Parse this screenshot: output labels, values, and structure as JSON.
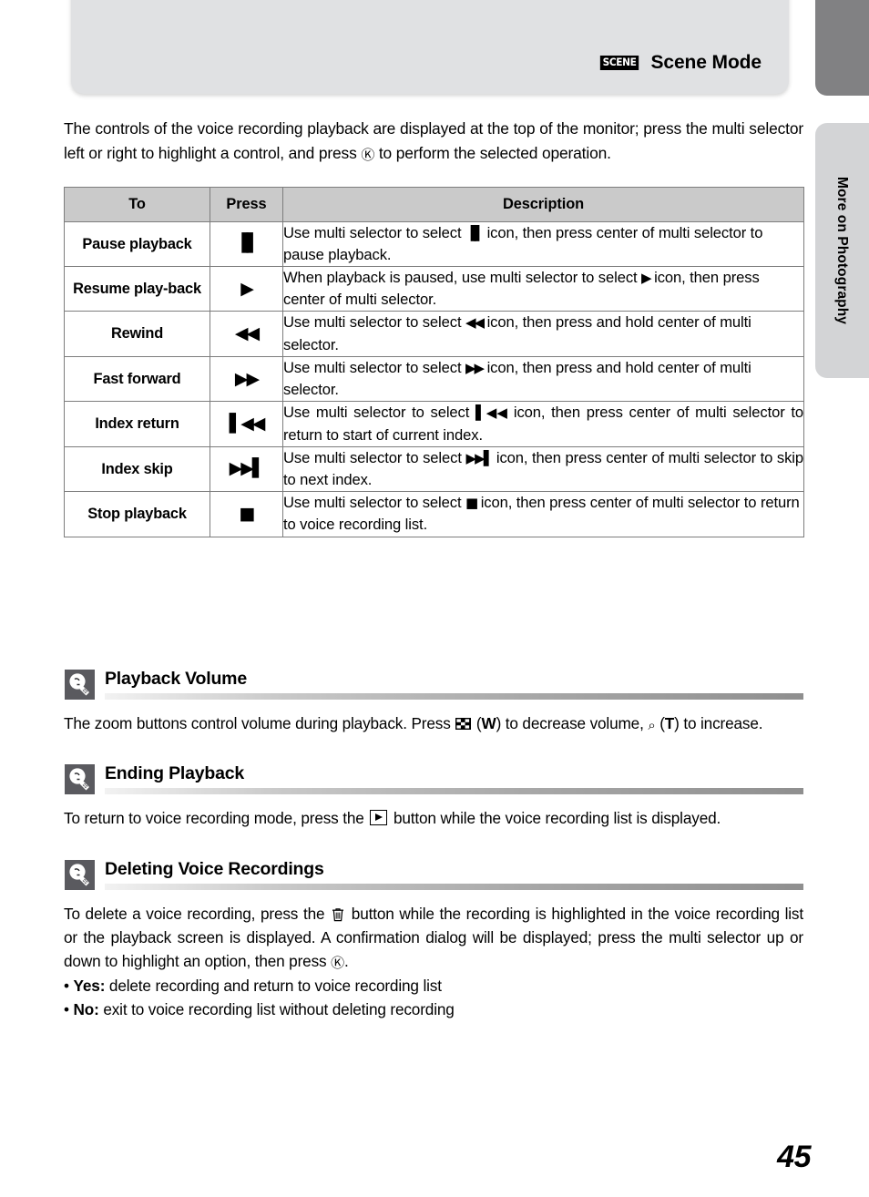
{
  "header": {
    "badge_label": "SCENE",
    "badge_icon": "scene-mode-icon",
    "title": "Scene Mode"
  },
  "side_tab": {
    "label": "More on Photography"
  },
  "intro": {
    "text_part1": "The controls of the voice recording playback are displayed at the top of the monitor; press the multi selector left or right to highlight a control, and press ",
    "ok_glyph": "Ⓚ",
    "text_part2": " to perform the selected operation."
  },
  "table": {
    "headers": {
      "to": "To",
      "press": "Press",
      "description": "Description"
    },
    "rows": [
      {
        "to": "Pause playback",
        "press_glyph": "▐▌",
        "press_icon": "pause-icon",
        "desc_pre": "Use multi selector to select ",
        "desc_glyph": "▐▌",
        "desc_post": " icon, then press center of multi selector to pause playback.",
        "justify": false
      },
      {
        "to": "Resume play-back",
        "press_glyph": "▶",
        "press_icon": "play-icon",
        "desc_pre": "When playback is paused, use multi selector to select ",
        "desc_glyph": "▶",
        "desc_post": " icon, then press center of multi selector.",
        "justify": false
      },
      {
        "to": "Rewind",
        "press_glyph": "◀◀",
        "press_icon": "rewind-icon",
        "desc_pre": "Use multi selector to select ",
        "desc_glyph": "◀◀",
        "desc_post": " icon, then press and hold center of multi selector.",
        "justify": false
      },
      {
        "to": "Fast forward",
        "press_glyph": "▶▶",
        "press_icon": "fast-forward-icon",
        "desc_pre": "Use multi selector to select ",
        "desc_glyph": "▶▶",
        "desc_post": " icon, then press and hold center of multi selector.",
        "justify": false
      },
      {
        "to": "Index return",
        "press_glyph": "▌◀◀",
        "press_icon": "index-return-icon",
        "desc_pre": "Use multi selector to select ",
        "desc_glyph": "▌◀◀",
        "desc_post": " icon, then press center of multi selector to return to start of current index.",
        "justify": true
      },
      {
        "to": "Index skip",
        "press_glyph": "▶▶▌",
        "press_icon": "index-skip-icon",
        "desc_pre": "Use multi selector to select ",
        "desc_glyph": "▶▶▌",
        "desc_post": " icon, then press center of multi selector to skip to next index.",
        "justify": true
      },
      {
        "to": "Stop playback",
        "press_glyph": "■",
        "press_icon": "stop-icon",
        "desc_pre": "Use multi selector to select ",
        "desc_glyph": "■",
        "desc_post": " icon, then press center of multi selector to return to voice recording list.",
        "justify": false
      }
    ]
  },
  "tips": [
    {
      "title": "Playback Volume",
      "icon": "lightbulb-tip-icon",
      "body_pre": "The zoom buttons control volume during playback. Press ",
      "thumb_icon": "thumbnail-wide-icon",
      "body_mid": " (",
      "w_label": "W",
      "body_mid2": ") to decrease volume, ",
      "zoom_glyph": "⌕",
      "t_label": "T",
      "body_post": ") to increase."
    },
    {
      "title": "Ending Playback",
      "icon": "lightbulb-tip-icon",
      "body_pre": "To return to voice recording mode, press the ",
      "play_button_icon": "playback-button-icon",
      "body_post": " button while the voice recording list is displayed."
    },
    {
      "title": "Deleting Voice Recordings",
      "icon": "lightbulb-tip-icon",
      "body_pre": "To delete a voice recording, press the ",
      "trash_icon": "trash-delete-icon",
      "body_mid": " button while the recording is highlighted in the voice recording list or the playback screen is displayed. A confirmation dialog will be displayed; press the multi selector up or down to highlight an option, then press ",
      "ok_glyph": "Ⓚ",
      "body_post": ".",
      "bullets": [
        {
          "marker": "•",
          "label": "Yes:",
          "text": " delete recording and return to voice recording list"
        },
        {
          "marker": "•",
          "label": "No:",
          "text": " exit to voice recording list without deleting recording"
        }
      ]
    }
  ],
  "page_number": "45"
}
